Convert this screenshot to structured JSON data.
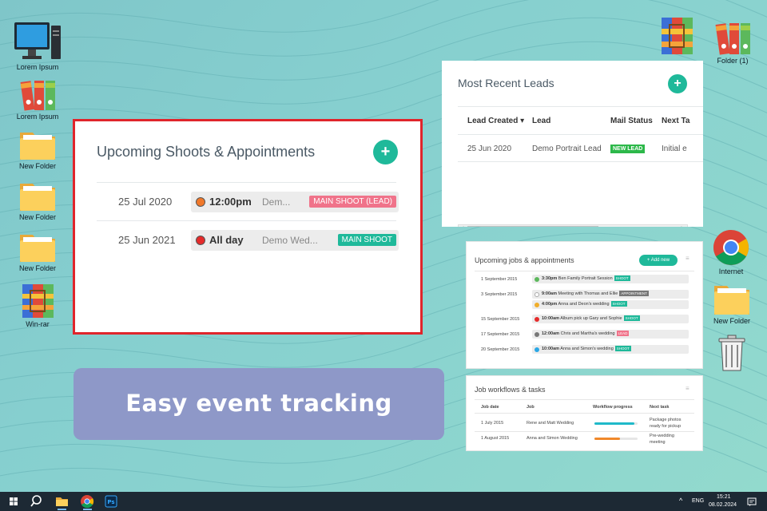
{
  "desktop": {
    "icons_left": [
      {
        "label": "Lorem Ipsum",
        "icon": "computer-icon"
      },
      {
        "label": "Lorem Ipsum",
        "icon": "binders-icon"
      },
      {
        "label": "New Folder",
        "icon": "folder-icon"
      },
      {
        "label": "New Folder",
        "icon": "folder-icon"
      },
      {
        "label": "New Folder",
        "icon": "folder-icon"
      },
      {
        "label": "Win-rar",
        "icon": "winrar-icon"
      }
    ],
    "icons_right": [
      {
        "label": "",
        "icon": "winrar-icon"
      },
      {
        "label": "Folder (1)",
        "icon": "binders-icon"
      },
      {
        "label": "Internet",
        "icon": "chrome-icon"
      },
      {
        "label": "New Folder",
        "icon": "folder-icon"
      },
      {
        "label": "",
        "icon": "recycle-bin-icon"
      }
    ]
  },
  "appointments": {
    "title": "Upcoming Shoots & Appointments",
    "add": "+",
    "rows": [
      {
        "date": "25 Jul 2020",
        "time": "12:00pm",
        "desc": "Dem...",
        "tag": "MAIN SHOOT (LEAD)",
        "dot_color": "#f0782a",
        "tag_color": "#f0738a"
      },
      {
        "date": "25 Jun 2021",
        "time": "All day",
        "desc": "Demo Wed...",
        "tag": "MAIN SHOOT",
        "dot_color": "#e52b2b",
        "tag_color": "#1fb99a"
      }
    ]
  },
  "leads": {
    "title": "Most Recent Leads",
    "add": "+",
    "columns": [
      "Lead Created ▾",
      "Lead",
      "Mail Status",
      "Next Ta"
    ],
    "rows": [
      {
        "created": "25 Jun 2020",
        "lead": "Demo Portrait Lead",
        "status": "NEW LEAD",
        "next": "Initial e"
      }
    ],
    "scroll_left": "◀",
    "scroll_right": "▶"
  },
  "jobs": {
    "title": "Upcoming jobs & appointments",
    "add_new": "+ Add new",
    "menu": "≡",
    "rows": [
      {
        "date": "1 September 2015",
        "items": [
          {
            "time": "3:30pm",
            "text": "Ben Family Portrait Session",
            "tag": "SHOOT",
            "tag_color": "#1fb99a",
            "dot": "#5cb85c"
          }
        ]
      },
      {
        "date": "3 September 2015",
        "items": [
          {
            "time": "9:00am",
            "text": "Meeting with Thomas and Ellie",
            "tag": "APPOINTMENT",
            "tag_color": "#777777",
            "dot": "#cccccc"
          },
          {
            "time": "4:00pm",
            "text": "Anna and Deon's wedding",
            "tag": "SHOOT",
            "tag_color": "#1fb99a",
            "dot": "#f0ad2a"
          }
        ]
      },
      {
        "date": "15 September 2015",
        "items": [
          {
            "time": "10:00am",
            "text": "Album pick up Gary and Sophie",
            "tag": "SHOOT",
            "tag_color": "#1fb99a",
            "dot": "#e52b2b"
          }
        ]
      },
      {
        "date": "17 September 2015",
        "items": [
          {
            "time": "12:00am",
            "text": "Chris and Martha's wedding",
            "tag": "LEAD",
            "tag_color": "#f0738a",
            "dot": "#777777"
          }
        ]
      },
      {
        "date": "20 September 2015",
        "items": [
          {
            "time": "10:00am",
            "text": "Anna and Simon's wedding",
            "tag": "SHOOT",
            "tag_color": "#1fb99a",
            "dot": "#2aa7e5"
          }
        ]
      }
    ]
  },
  "tasks": {
    "title": "Job workflows & tasks",
    "menu": "≡",
    "columns": [
      "Job date",
      "Job",
      "Workflow progress",
      "Next task"
    ],
    "rows": [
      {
        "date": "1 July 2015",
        "job": "Rene and Matt Wedding",
        "progress": 0.92,
        "color": "#1fb9c9",
        "next": [
          "Package photos",
          "ready for pickup"
        ]
      },
      {
        "date": "1 August 2015",
        "job": "Anna and Simon Wedding",
        "progress": 0.6,
        "color": "#f0882a",
        "next": [
          "Pre-wedding",
          "meeting"
        ]
      }
    ]
  },
  "banner": {
    "text": "Easy event tracking"
  },
  "taskbar": {
    "lang": "ENG",
    "time": "15:21",
    "date": "08.02.2024",
    "up_arrow": "^"
  }
}
